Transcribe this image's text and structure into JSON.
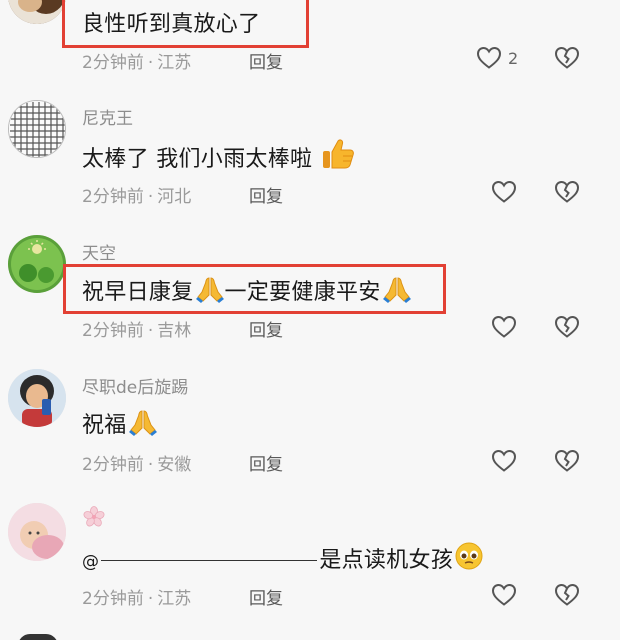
{
  "comments": [
    {
      "user": "",
      "text": "良性听到真放心了",
      "time": "2分钟前",
      "location": "江苏",
      "reply_label": "回复",
      "likes": "2",
      "highlighted": true
    },
    {
      "user": "尼克王",
      "text": "太棒了 我们小雨太棒啦",
      "emoji": "thumbs-up",
      "time": "2分钟前",
      "location": "河北",
      "reply_label": "回复",
      "highlighted": false
    },
    {
      "user": "天空",
      "text_part1": "祝早日康复",
      "text_part2": "一定要健康平安",
      "emoji": "praying-hands",
      "time": "2分钟前",
      "location": "吉林",
      "reply_label": "回复",
      "highlighted": true
    },
    {
      "user": "尽职de后旋踢",
      "text": "祝福",
      "emoji": "praying-hands",
      "time": "2分钟前",
      "location": "安徽",
      "reply_label": "回复",
      "highlighted": false
    },
    {
      "user": "",
      "user_emoji": "cherry-blossom",
      "text_prefix": "@",
      "text_suffix": "是点读机女孩",
      "emoji": "pleading-face",
      "time": "2分钟前",
      "location": "江苏",
      "reply_label": "回复",
      "highlighted": false
    }
  ],
  "colors": {
    "background": "#f7f7f7",
    "highlight": "#e24034",
    "meta": "#9a9a9a",
    "icon": "#555555"
  }
}
